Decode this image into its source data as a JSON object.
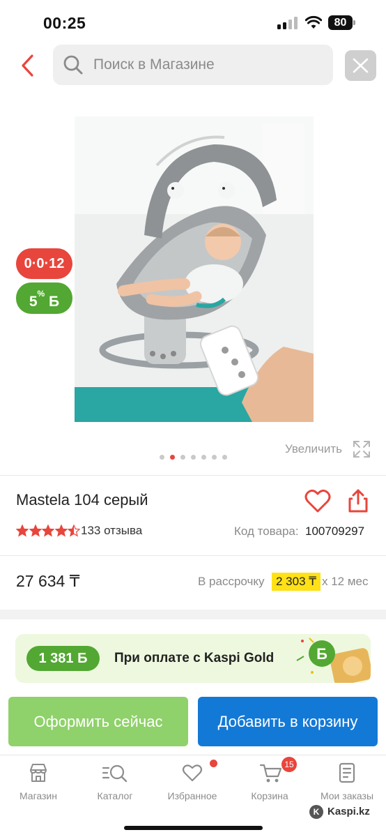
{
  "status_bar": {
    "time": "00:25",
    "battery": "80"
  },
  "header": {
    "search_placeholder": "Поиск в Магазине"
  },
  "product": {
    "installment_badge": "0·0·12",
    "bonus_badge": "5",
    "bonus_badge_suffix": "%",
    "bonus_badge_currency": "Б",
    "gallery": {
      "slide_count": 7,
      "active_index": 1
    },
    "zoom_label": "Увеличить",
    "title": "Mastela 104 серый",
    "rating": 4.5,
    "reviews": "133 отзыва",
    "sku_label": "Код товара:",
    "sku_value": "100709297",
    "price": "27 634 ₸",
    "installment_label": "В рассрочку",
    "installment_amount": "2 303 ₸",
    "installment_term": "x 12 мес"
  },
  "kaspi_gold": {
    "bonus": "1 381 Б",
    "text": "При оплате с Kaspi Gold"
  },
  "actions": {
    "checkout": "Оформить сейчас",
    "add_to_cart": "Добавить в корзину"
  },
  "tab_bar": {
    "items": [
      {
        "label": "Магазин",
        "icon": "store-icon"
      },
      {
        "label": "Каталог",
        "icon": "catalog-search-icon"
      },
      {
        "label": "Избранное",
        "icon": "heart-icon"
      },
      {
        "label": "Корзина",
        "icon": "cart-icon"
      },
      {
        "label": "Мои заказы",
        "icon": "orders-icon"
      }
    ],
    "cart_count": "15"
  },
  "watermark": "Kaspi.kz",
  "colors": {
    "kaspi_red": "#e8453c",
    "bonus_green": "#52a832",
    "cart_blue": "#1379d6",
    "checkout_green": "#8fd16a",
    "installment_yellow": "#ffe115"
  }
}
